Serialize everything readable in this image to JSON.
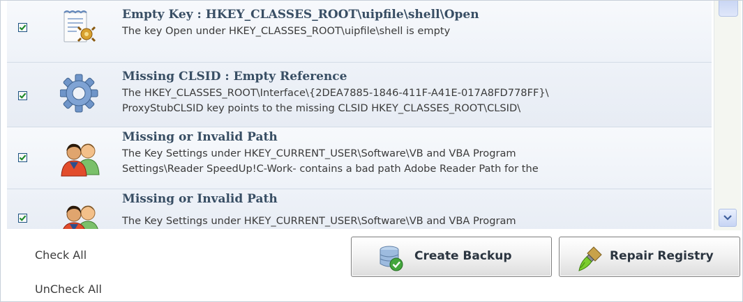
{
  "results": [
    {
      "checked": true,
      "icon": "registry-key-document-icon",
      "title": "Empty Key : HKEY_CLASSES_ROOT\\uipfile\\shell\\Open",
      "lines": [
        "The key Open under HKEY_CLASSES_ROOT\\uipfile\\shell is empty"
      ]
    },
    {
      "checked": true,
      "icon": "gear-icon",
      "title": "Missing CLSID : Empty Reference",
      "lines": [
        "The HKEY_CLASSES_ROOT\\Interface\\{2DEA7885-1846-411F-A41E-017A8FD778FF}\\",
        "ProxyStubCLSID key points to the missing CLSID HKEY_CLASSES_ROOT\\CLSID\\"
      ]
    },
    {
      "checked": true,
      "icon": "users-icon",
      "title": "Missing or Invalid Path",
      "lines": [
        "The Key Settings under HKEY_CURRENT_USER\\Software\\VB and VBA Program",
        "Settings\\Reader SpeedUp!C-Work- contains a bad path Adobe Reader Path for the"
      ]
    },
    {
      "checked": true,
      "icon": "users-icon",
      "title": "Missing or Invalid Path",
      "lines": [
        "The Key Settings under HKEY_CURRENT_USER\\Software\\VB and VBA Program"
      ]
    }
  ],
  "links": {
    "check_all": "Check All",
    "uncheck_all": "UnCheck All"
  },
  "buttons": {
    "create_backup": "Create Backup",
    "repair_registry": "Repair Registry"
  },
  "colors": {
    "title_text": "#384e64",
    "row_background": "#eef2f8",
    "checkbox_border": "#1c5180",
    "check_mark": "#1f8a2a"
  }
}
